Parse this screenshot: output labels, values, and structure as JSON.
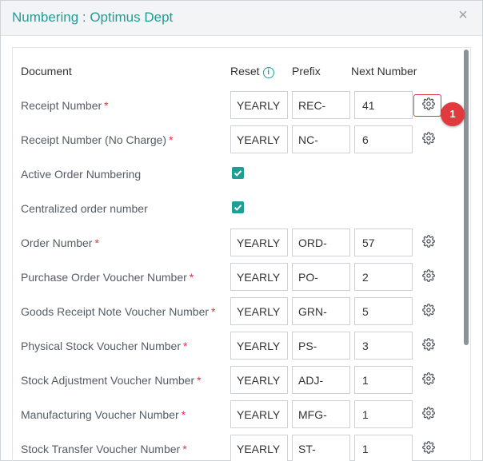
{
  "dialog": {
    "title": "Numbering : Optimus Dept",
    "close_label": "×"
  },
  "columns": {
    "document": "Document",
    "reset": "Reset",
    "reset_info": "i",
    "prefix": "Prefix",
    "next_number": "Next Number"
  },
  "rows": [
    {
      "label": "Receipt Number",
      "required": true,
      "type": "fields",
      "reset": "YEARLY",
      "prefix": "REC-",
      "next": "41"
    },
    {
      "label": "Receipt Number (No Charge)",
      "required": true,
      "type": "fields",
      "reset": "YEARLY",
      "prefix": "NC-",
      "next": "6"
    },
    {
      "label": "Active Order Numbering",
      "required": false,
      "type": "checkbox",
      "checked": true
    },
    {
      "label": "Centralized order number",
      "required": false,
      "type": "checkbox",
      "checked": true
    },
    {
      "label": "Order Number",
      "required": true,
      "type": "fields",
      "reset": "YEARLY",
      "prefix": "ORD-",
      "next": "57"
    },
    {
      "label": "Purchase Order Voucher Number",
      "required": true,
      "type": "fields",
      "reset": "YEARLY",
      "prefix": "PO-",
      "next": "2"
    },
    {
      "label": "Goods Receipt Note Voucher Number",
      "required": true,
      "type": "fields",
      "reset": "YEARLY",
      "prefix": "GRN-",
      "next": "5"
    },
    {
      "label": "Physical Stock Voucher Number",
      "required": true,
      "type": "fields",
      "reset": "YEARLY",
      "prefix": "PS-",
      "next": "3"
    },
    {
      "label": "Stock Adjustment Voucher Number",
      "required": true,
      "type": "fields",
      "reset": "YEARLY",
      "prefix": "ADJ-",
      "next": "1"
    },
    {
      "label": "Manufacturing Voucher Number",
      "required": true,
      "type": "fields",
      "reset": "YEARLY",
      "prefix": "MFG-",
      "next": "1"
    },
    {
      "label": "Stock Transfer Voucher Number",
      "required": true,
      "type": "fields",
      "reset": "YEARLY",
      "prefix": "ST-",
      "next": "1"
    }
  ],
  "annotation": {
    "badge": "1"
  },
  "required_mark": "*",
  "colors": {
    "accent": "#1f9e96",
    "required": "#e5323f",
    "annotation": "#e03a3e"
  },
  "icons": {
    "settings": "gear-icon",
    "close": "close-icon",
    "info": "info-icon",
    "checkbox": "checkmark-icon"
  }
}
